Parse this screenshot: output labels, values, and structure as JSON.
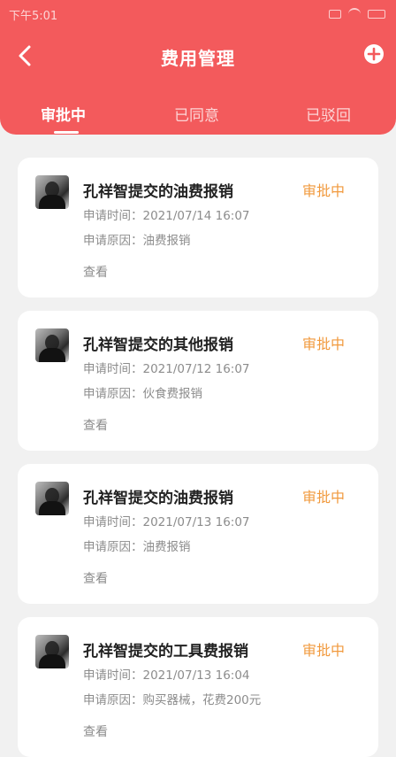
{
  "status_bar": {
    "time": "下午5:01"
  },
  "header": {
    "title": "费用管理"
  },
  "icons": {
    "back": "chevron-left-icon",
    "add": "plus-circle-icon"
  },
  "tabs": [
    {
      "label": "审批中",
      "active": true
    },
    {
      "label": "已同意",
      "active": false
    },
    {
      "label": "已驳回",
      "active": false
    }
  ],
  "colors": {
    "header_bg": "#f35a5c",
    "status_accent": "#f19a3e"
  },
  "cards": [
    {
      "title": "孔祥智提交的油费报销",
      "status": "审批中",
      "apply_time": "申请时间：2021/07/14 16:07",
      "reason": "申请原因：油费报销",
      "action": "查看"
    },
    {
      "title": "孔祥智提交的其他报销",
      "status": "审批中",
      "apply_time": "申请时间：2021/07/12 16:07",
      "reason": "申请原因：伙食费报销",
      "action": "查看"
    },
    {
      "title": "孔祥智提交的油费报销",
      "status": "审批中",
      "apply_time": "申请时间：2021/07/13 16:07",
      "reason": "申请原因：油费报销",
      "action": "查看"
    },
    {
      "title": "孔祥智提交的工具费报销",
      "status": "审批中",
      "apply_time": "申请时间：2021/07/13 16:04",
      "reason": "申请原因：购买器械，花费200元",
      "action": "查看"
    }
  ]
}
